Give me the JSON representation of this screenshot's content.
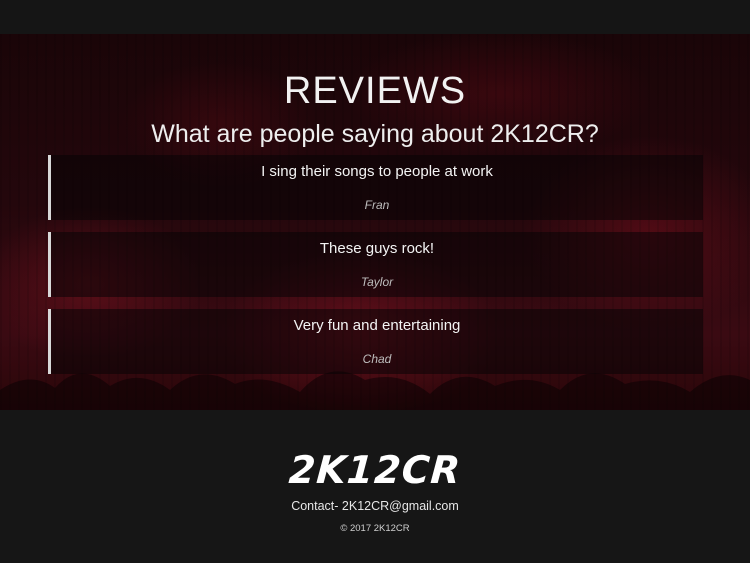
{
  "reviews_section": {
    "heading": "REVIEWS",
    "subheading": "What are people saying about 2K12CR?",
    "items": [
      {
        "quote": "I sing their songs to people at work",
        "author": "Fran"
      },
      {
        "quote": "These guys rock!",
        "author": "Taylor"
      },
      {
        "quote": "Very fun and entertaining",
        "author": "Chad"
      }
    ]
  },
  "footer": {
    "logo": "2K12CR",
    "contact": "Contact- 2K12CR@gmail.com",
    "copyright": "© 2017 2K12CR"
  },
  "colors": {
    "page_background": "#161616",
    "hero_tint": "#2a0609",
    "review_border": "#d8d8d8",
    "text_primary": "#ffffff",
    "author_text": "#bdbdbd"
  }
}
